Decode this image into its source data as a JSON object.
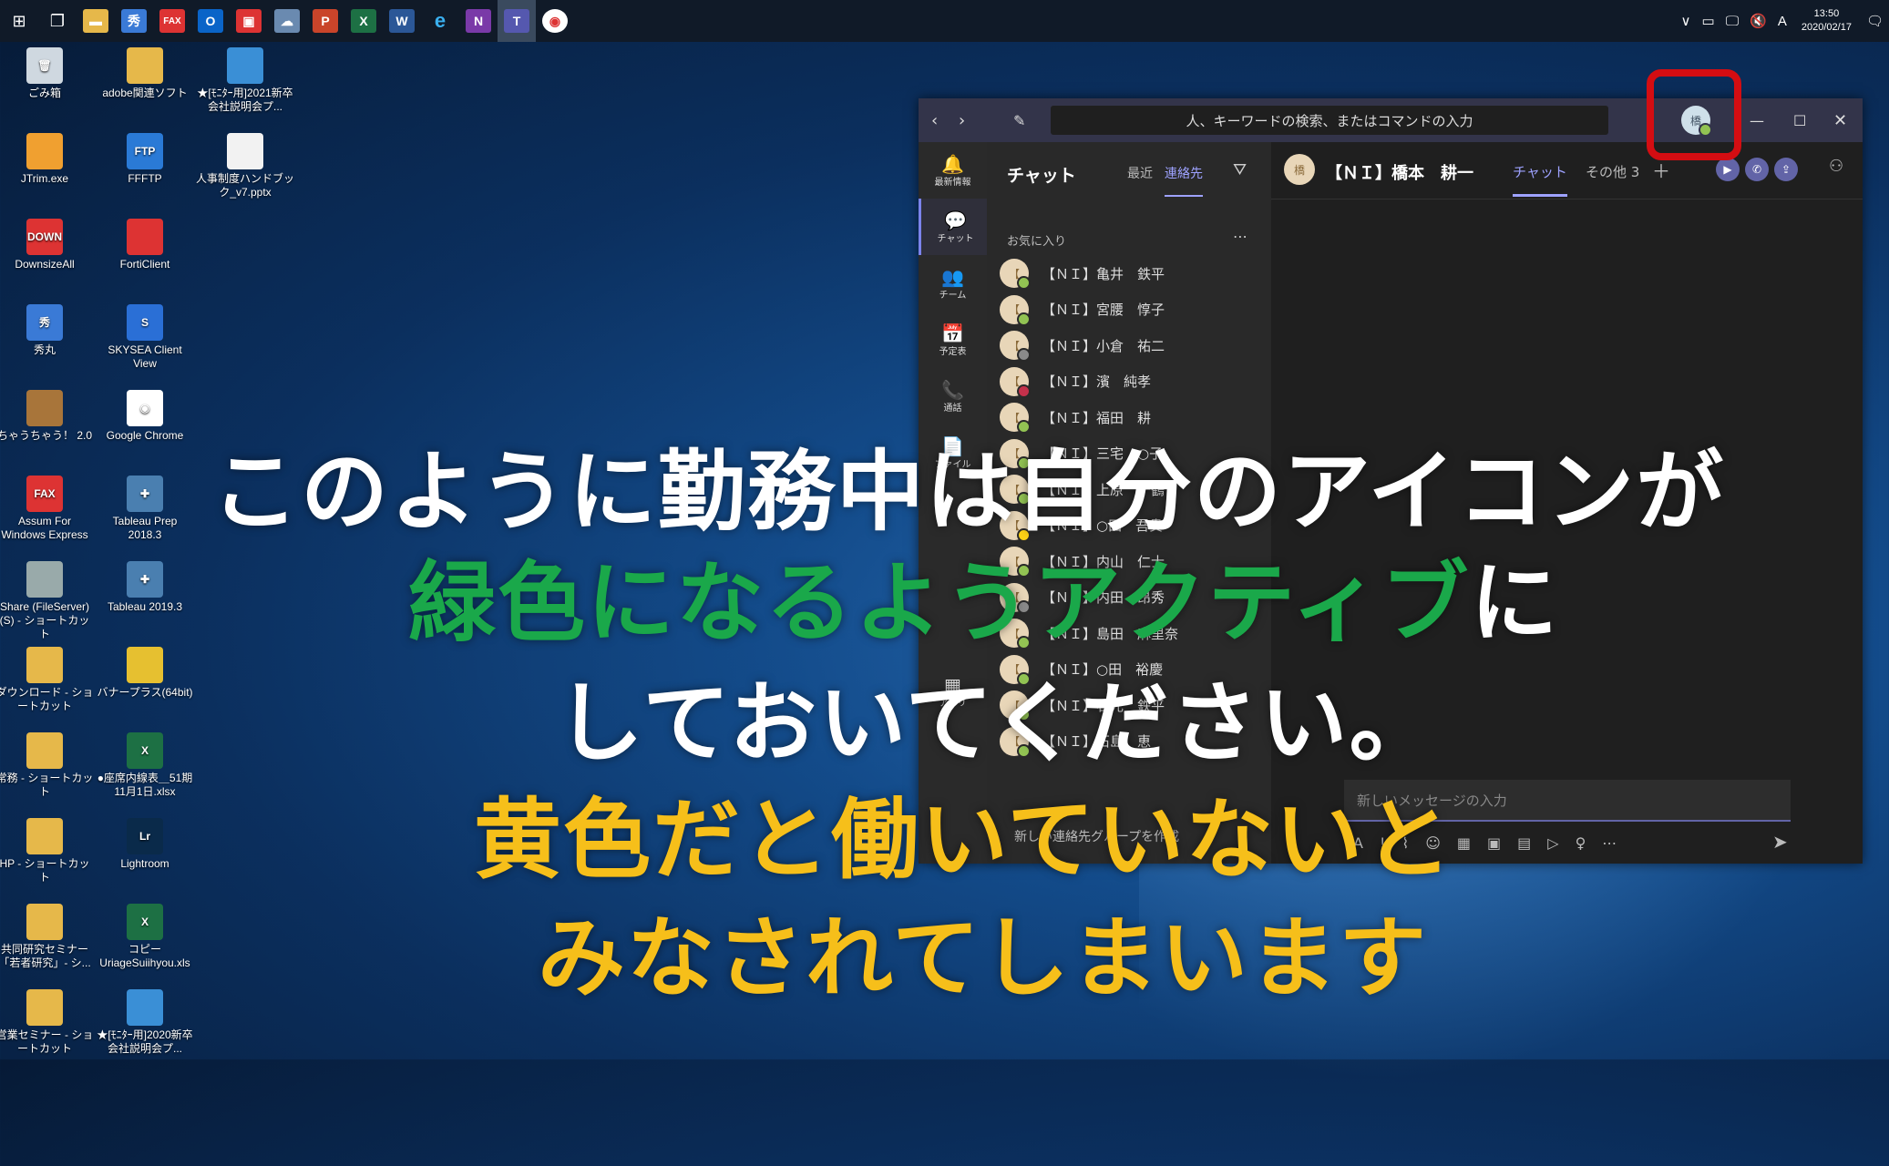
{
  "taskbar": {
    "icons": [
      "start-icon",
      "task-view-icon",
      "file-explorer-icon",
      "shuumaru-icon",
      "fax-icon",
      "outlook-icon",
      "forticlient-icon",
      "cloud-icon",
      "powerpoint-icon",
      "excel-icon",
      "word-icon",
      "ie-icon",
      "onenote-icon",
      "teams-icon",
      "chrome-icon"
    ],
    "tray_ime": "A",
    "time": "13:50",
    "date": "2020/02/17"
  },
  "desktop": {
    "icons": [
      {
        "label": "ごみ箱",
        "col": 0,
        "row": 0,
        "color": "#cfd8e0",
        "glyph": "🗑"
      },
      {
        "label": "adobe関連ソフト",
        "col": 1,
        "row": 0,
        "color": "#e6b84a",
        "glyph": ""
      },
      {
        "label": "★[ﾓﾆﾀｰ用]2021新卒会社説明会プ...",
        "col": 2,
        "row": 0,
        "color": "#3a8fd6",
        "glyph": ""
      },
      {
        "label": "JTrim.exe",
        "col": 0,
        "row": 1,
        "color": "#f0a030",
        "glyph": ""
      },
      {
        "label": "FFFTP",
        "col": 1,
        "row": 1,
        "color": "#2a7ad6",
        "glyph": "FTP"
      },
      {
        "label": "人事制度ハンドブック_v7.pptx",
        "col": 2,
        "row": 1,
        "color": "#f2f2f2",
        "glyph": ""
      },
      {
        "label": "DownsizeAll",
        "col": 0,
        "row": 2,
        "color": "#d33",
        "glyph": "DOWN"
      },
      {
        "label": "FortiClient",
        "col": 1,
        "row": 2,
        "color": "#d33",
        "glyph": ""
      },
      {
        "label": "秀丸",
        "col": 0,
        "row": 3,
        "color": "#3a7ad6",
        "glyph": "秀"
      },
      {
        "label": "SKYSEA Client View",
        "col": 1,
        "row": 3,
        "color": "#2a6fd6",
        "glyph": "S"
      },
      {
        "label": "ちゃうちゃう！ 2.0",
        "col": 0,
        "row": 4,
        "color": "#a8753a",
        "glyph": ""
      },
      {
        "label": "Google Chrome",
        "col": 1,
        "row": 4,
        "color": "#ffffff",
        "glyph": "◉"
      },
      {
        "label": "Assum For Windows Express",
        "col": 0,
        "row": 5,
        "color": "#d33",
        "glyph": "FAX"
      },
      {
        "label": "Tableau Prep 2018.3",
        "col": 1,
        "row": 5,
        "color": "#4a7fb0",
        "glyph": "✚"
      },
      {
        "label": "Share (FileServer) (S) - ショートカット",
        "col": 0,
        "row": 6,
        "color": "#9aa",
        "glyph": ""
      },
      {
        "label": "Tableau 2019.3",
        "col": 1,
        "row": 6,
        "color": "#4a7fb0",
        "glyph": "✚"
      },
      {
        "label": "ダウンロード - ショートカット",
        "col": 0,
        "row": 7,
        "color": "#e6b84a",
        "glyph": ""
      },
      {
        "label": "バナープラス(64bit)",
        "col": 1,
        "row": 7,
        "color": "#e6c030",
        "glyph": ""
      },
      {
        "label": "常務 - ショートカット",
        "col": 0,
        "row": 8,
        "color": "#e6b84a",
        "glyph": ""
      },
      {
        "label": "●座席内線表＿51期11月1日.xlsx",
        "col": 1,
        "row": 8,
        "color": "#1d7044",
        "glyph": "X"
      },
      {
        "label": "HP - ショートカット",
        "col": 0,
        "row": 9,
        "color": "#e6b84a",
        "glyph": ""
      },
      {
        "label": "Lightroom",
        "col": 1,
        "row": 9,
        "color": "#0a2a4a",
        "glyph": "Lr"
      },
      {
        "label": "共同研究セミナー「若者研究」- シ...",
        "col": 0,
        "row": 10,
        "color": "#e6b84a",
        "glyph": ""
      },
      {
        "label": "コピー UriageSuiihyou.xls",
        "col": 1,
        "row": 10,
        "color": "#1d7044",
        "glyph": "X"
      },
      {
        "label": "営業セミナー - ショートカット",
        "col": 0,
        "row": 11,
        "color": "#e6b84a",
        "glyph": ""
      },
      {
        "label": "★[ﾓﾆﾀｰ用]2020新卒会社説明会プ...",
        "col": 1,
        "row": 11,
        "color": "#3a8fd6",
        "glyph": ""
      }
    ]
  },
  "teams": {
    "search_placeholder": "人、キーワードの検索、またはコマンドの入力",
    "rail": [
      {
        "label": "最新情報",
        "icon": "🔔"
      },
      {
        "label": "チャット",
        "icon": "💬",
        "active": true
      },
      {
        "label": "チーム",
        "icon": "👥"
      },
      {
        "label": "予定表",
        "icon": "📅"
      },
      {
        "label": "通話",
        "icon": "📞"
      },
      {
        "label": "ファイル",
        "icon": "📄"
      },
      {
        "label": "アプリ",
        "icon": "▦"
      }
    ],
    "list_title": "チャット",
    "tab_recent": "最近",
    "tab_contacts": "連絡先",
    "section_favorites": "お気に入り",
    "contacts": [
      {
        "name": "【ＮＩ】亀井　鉄平",
        "status": "#92c353"
      },
      {
        "name": "【ＮＩ】宮腰　惇子",
        "status": "#92c353"
      },
      {
        "name": "【ＮＩ】小倉　祐二",
        "status": "#8a8a8a"
      },
      {
        "name": "【ＮＩ】濱　純孝",
        "status": "#c4314b"
      },
      {
        "name": "【ＮＩ】福田　耕",
        "status": "#92c353"
      },
      {
        "name": "【ＮＩ】三宅　○子",
        "status": "#92c353"
      },
      {
        "name": "【ＮＩ】上原　千鶴",
        "status": "#92c353"
      },
      {
        "name": "【ＮＩ】○田　吾貴",
        "status": "#fcd116"
      },
      {
        "name": "【ＮＩ】内山　仁士",
        "status": "#92c353"
      },
      {
        "name": "【ＮＩ】内田　昂秀",
        "status": "#8a8a8a"
      },
      {
        "name": "【ＮＩ】島田　麻里奈",
        "status": "#92c353"
      },
      {
        "name": "【ＮＩ】○田　裕慶",
        "status": "#92c353"
      },
      {
        "name": "【ＮＩ】石元　鉄平",
        "status": "#92c353"
      },
      {
        "name": "【ＮＩ】石島　恵",
        "status": "#92c353"
      }
    ],
    "new_chat": "新しい連絡先グループを作成",
    "chat_header_name": "【ＮＩ】橋本　耕一",
    "chat_tab_chat": "チャット",
    "chat_tab_more": "その他 3",
    "compose_placeholder": "新しいメッセージの入力",
    "my_avatar": "橋"
  },
  "overlay": {
    "line1": "このように勤務中は自分のアイコンが",
    "line2_green": "緑色になるようアクティブ",
    "line2_white": "に",
    "line3": "しておいてください。",
    "line4": "黄色だと働いていないと",
    "line5": "みなされてしまいます",
    "colors": {
      "white": "#ffffff",
      "green": "#1aa84a",
      "yellow": "#f6bf1a"
    }
  }
}
